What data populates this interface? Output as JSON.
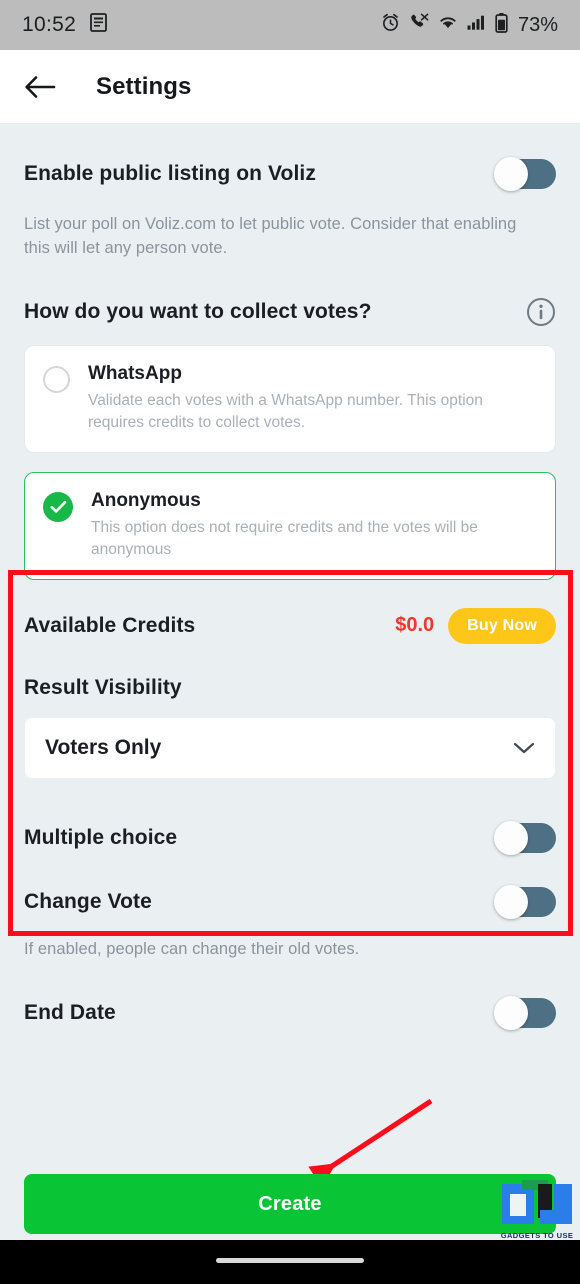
{
  "statusbar": {
    "time": "10:52",
    "battery_percent": "73%",
    "icons": [
      "document-icon",
      "alarm-icon",
      "call-mute-icon",
      "wifi-icon",
      "cellular-signal-icon",
      "battery-icon"
    ]
  },
  "appbar": {
    "back_icon": "arrow-left-icon",
    "title": "Settings"
  },
  "public_listing": {
    "label": "Enable public listing on Voliz",
    "description": "List your poll on Voliz.com to let public vote. Consider that enabling this will let any person vote.",
    "toggle_state": "off"
  },
  "collect_votes": {
    "heading": "How do you want to collect votes?",
    "info_icon": "info-icon",
    "options": [
      {
        "title": "WhatsApp",
        "description": "Validate each votes with a WhatsApp number. This option requires credits to collect votes.",
        "selected": false
      },
      {
        "title": "Anonymous",
        "description": "This option does not require credits and the votes will be anonymous",
        "selected": true
      }
    ]
  },
  "credits": {
    "label": "Available Credits",
    "amount": "$0.0",
    "buy_label": "Buy Now"
  },
  "result_visibility": {
    "label": "Result Visibility",
    "selected_value": "Voters Only",
    "chevron_icon": "chevron-down-icon"
  },
  "multiple_choice": {
    "label": "Multiple choice",
    "toggle_state": "off"
  },
  "change_vote": {
    "label": "Change Vote",
    "description": "If enabled, people can change their old votes.",
    "toggle_state": "off"
  },
  "end_date": {
    "label": "End Date",
    "toggle_state": "off"
  },
  "create": {
    "label": "Create"
  },
  "annotations": {
    "highlight_color": "#fc0d1b",
    "arrow_color": "#fc0d1b",
    "arrow_target": "create-button"
  },
  "watermark": {
    "text": "GADGETS TO USE",
    "primary_color": "#2b7de9",
    "secondary_color": "#1b9e4b"
  },
  "colors": {
    "background": "#eaeff2",
    "toggle_track": "#4e7085",
    "accent_green": "#09c435",
    "selected_green": "#16b948",
    "credit_red": "#f0372f",
    "buy_yellow": "#ffc61a"
  }
}
